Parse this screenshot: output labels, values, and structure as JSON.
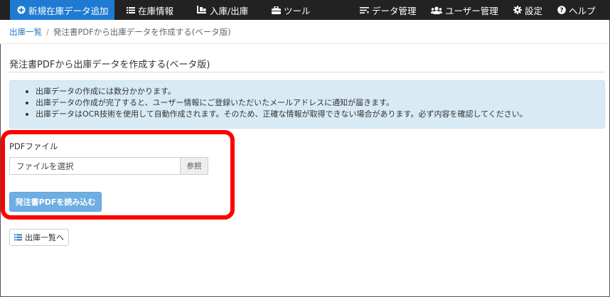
{
  "nav": {
    "items": [
      {
        "label": "新規在庫データ追加",
        "icon": "plus-circle-icon",
        "active": true
      },
      {
        "label": "在庫情報",
        "icon": "list-icon"
      },
      {
        "label": "入庫/出庫",
        "icon": "dolly-icon"
      },
      {
        "label": "ツール",
        "icon": "toolbox-icon"
      },
      {
        "label": "データ管理",
        "icon": "sliders-icon"
      },
      {
        "label": "ユーザー管理",
        "icon": "users-icon"
      },
      {
        "label": "設定",
        "icon": "gear-icon"
      },
      {
        "label": "ヘルプ",
        "icon": "question-circle-icon"
      }
    ],
    "active_color": "#1f7bd1",
    "background": "#222222"
  },
  "breadcrumb": {
    "items": [
      {
        "label": "出庫一覧",
        "link": true
      },
      {
        "label": "発注書PDFから出庫データを作成する(ベータ版)",
        "link": false
      }
    ],
    "separator": "/"
  },
  "page": {
    "title": "発注書PDFから出庫データを作成する(ベータ版)"
  },
  "alert": {
    "items": [
      "出庫データの作成には数分かかります。",
      "出庫データの作成が完了すると、ユーザー情報にご登録いただいたメールアドレスに通知が届きます。",
      "出庫データはOCR技術を使用して自動作成されます。そのため、正確な情報が取得できない場合があります。必ず内容を確認してください。"
    ],
    "background": "#d8ebf5"
  },
  "form": {
    "file_label": "PDFファイル",
    "file_placeholder": "ファイルを選択",
    "browse_label": "参照",
    "submit_label": "発注書PDFを読み込む",
    "submit_color": "#6eaee2"
  },
  "back_button": {
    "label": "出庫一覧へ",
    "icon": "list-icon"
  },
  "highlight": {
    "color": "#ff0000"
  }
}
